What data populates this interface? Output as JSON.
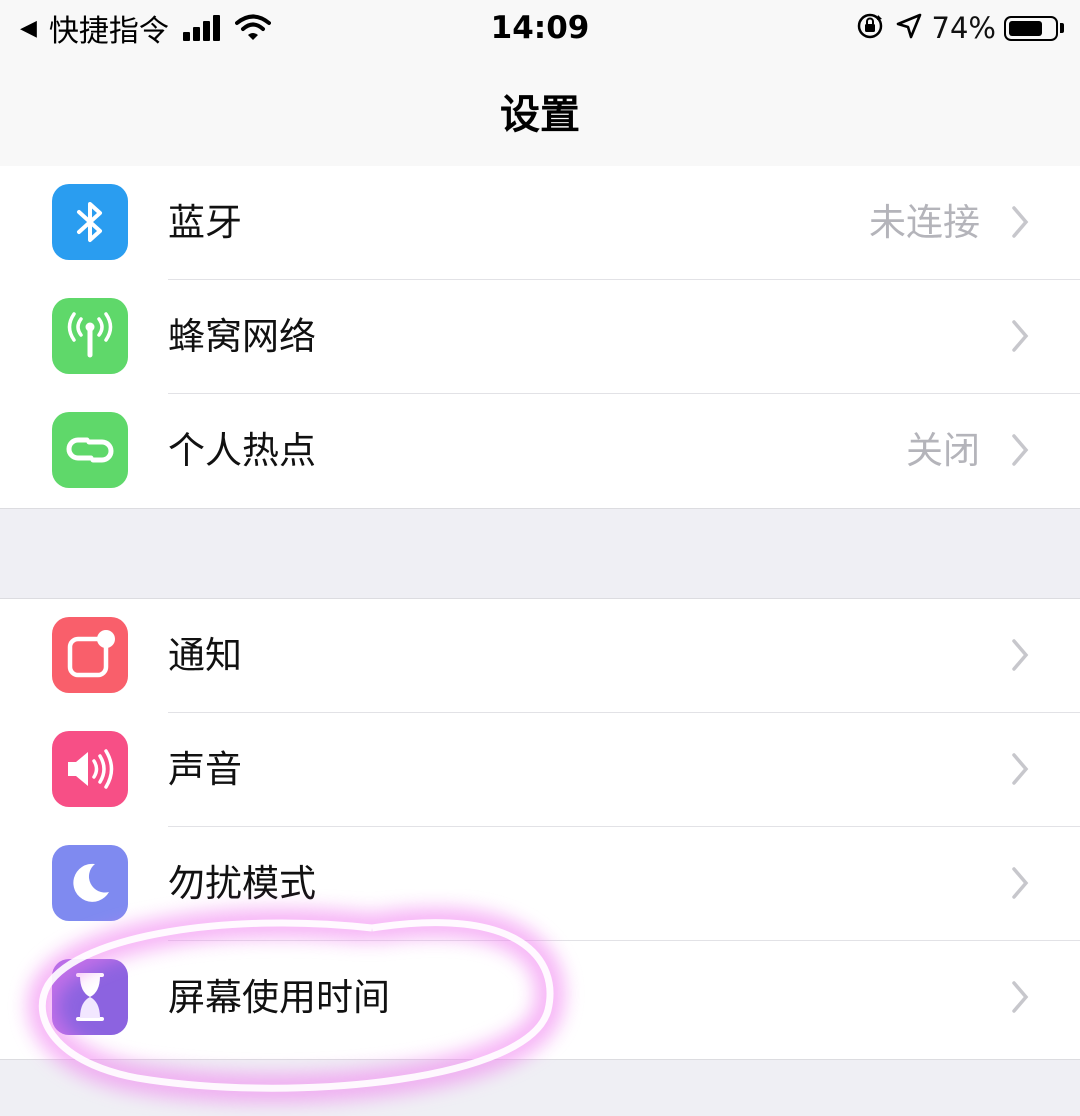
{
  "status_bar": {
    "back_arrow": "◀",
    "back_app": "快捷指令",
    "time": "14:09",
    "battery_percent": "74%",
    "battery_level": 0.74,
    "icons": [
      "signal-icon",
      "wifi-icon",
      "orientation-lock-icon",
      "location-icon",
      "battery-icon"
    ]
  },
  "nav": {
    "title": "设置"
  },
  "groups": [
    {
      "rows": [
        {
          "label": "蓝牙",
          "value": "未连接",
          "icon": "bluetooth-icon",
          "color": "#2a9df0"
        },
        {
          "label": "蜂窝网络",
          "value": "",
          "icon": "cellular-icon",
          "color": "#5fd86a"
        },
        {
          "label": "个人热点",
          "value": "关闭",
          "icon": "hotspot-icon",
          "color": "#5fd86a"
        }
      ]
    },
    {
      "rows": [
        {
          "label": "通知",
          "value": "",
          "icon": "notifications-icon",
          "color": "#f95f6b"
        },
        {
          "label": "声音",
          "value": "",
          "icon": "sound-icon",
          "color": "#f74f86"
        },
        {
          "label": "勿扰模式",
          "value": "",
          "icon": "moon-icon",
          "color": "#7f8af0"
        },
        {
          "label": "屏幕使用时间",
          "value": "",
          "icon": "hourglass-icon",
          "color": "#8c63e0"
        }
      ]
    }
  ],
  "annotation": {
    "color": "#f07cf0"
  }
}
